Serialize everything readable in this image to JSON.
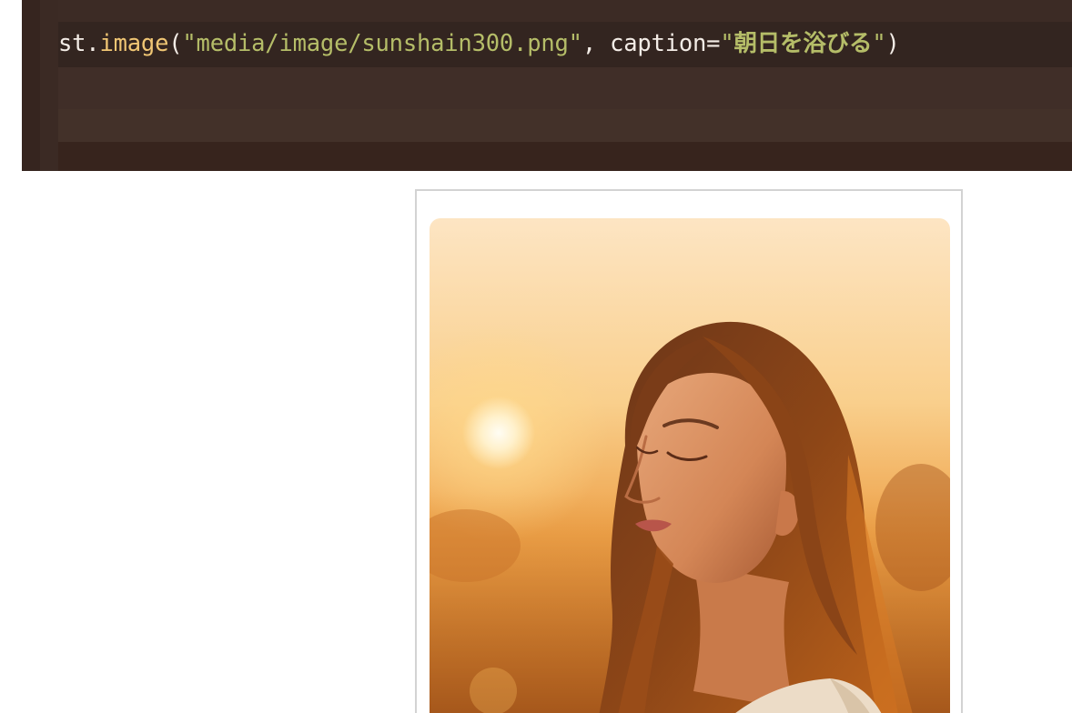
{
  "code": {
    "tokens": {
      "obj": "st.",
      "fn": "image",
      "open": "(",
      "path": "\"media/image/sunshain300.png\"",
      "sep": ", caption=",
      "caption_quote_open": "\"",
      "caption_text": "朝日を浴びる",
      "caption_quote_close": "\"",
      "close": ")"
    }
  },
  "image": {
    "subject": "woman with eyes closed in sunrise light",
    "icon": "photo-image"
  },
  "colors": {
    "code_bg": "#3f2e27",
    "code_line_bg": "#332520",
    "string": "#b5bd68",
    "function": "#f0c674",
    "text": "#f3ece6",
    "card_border": "#d3d3d3"
  }
}
